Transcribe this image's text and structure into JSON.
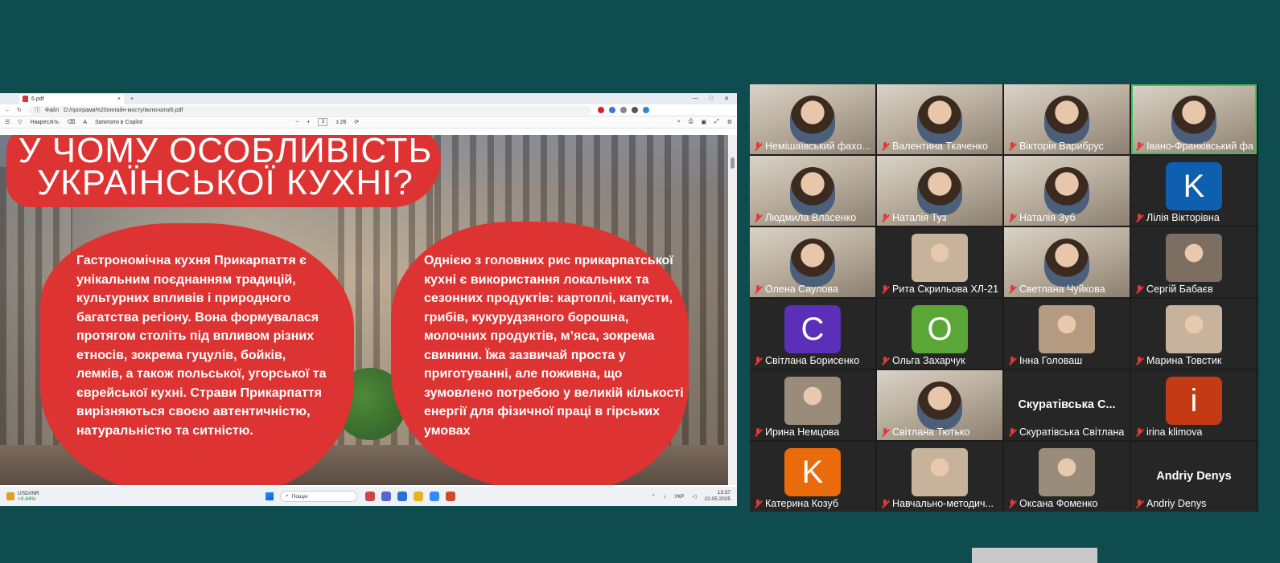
{
  "browser": {
    "tab_title": "6.pdf",
    "tab_close": "×",
    "new_tab": "+",
    "file_label": "Файл",
    "url": "D:/програма%20онлайн-мосту/включати/6.pdf",
    "draw_label": "Накресліть",
    "ask_copilot": "Запитати в Copilot",
    "page_current": "3",
    "page_total": "з 26",
    "zoom_minus": "−",
    "zoom_plus": "+"
  },
  "slide": {
    "title_line1": "У ЧОМУ ОСОБЛИВІСТЬ",
    "title_line2": "УКРАЇНСЬКОЇ КУХНІ?",
    "left_text": "Гастрономічна кухня Прикарпаття є унікальним поєднанням традицій, культурних впливів і природного багатства регіону. Вона формувалася протягом століть під впливом різних етносів, зокрема гуцулів, бойків, лемків, а також польської, угорської та єврейської кухні. Страви Прикарпаття вирізняються своєю автентичністю, натуральністю та ситністю.",
    "right_text": "Однією з головних рис прикарпатської кухні є використання локальних та сезонних продуктів: картоплі, капусти, грибів, кукурудзяного борошна, молочних продуктів, м’яса, зокрема свинини. Їжа зазвичай проста у приготуванні, але поживна, що зумовлено потребою у великій кількості енергії для фізичної праці в гірських умовах",
    "accent_color": "#dd3333"
  },
  "taskbar": {
    "ticker": "USD/INR",
    "ticker_change": "+0.44%",
    "search_placeholder": "Пошук",
    "lang": "УКР",
    "time": "13:37",
    "date": "22.05.2025"
  },
  "participants": [
    {
      "name": "Немішаївський фахо...",
      "type": "video"
    },
    {
      "name": "Валентина Ткаченко",
      "type": "video"
    },
    {
      "name": "Вікторія Варибрус",
      "type": "video"
    },
    {
      "name": "Івано-Франківський фах...",
      "type": "video",
      "active": true
    },
    {
      "name": "Людмила Власенко",
      "type": "video"
    },
    {
      "name": "Наталія Туз",
      "type": "video"
    },
    {
      "name": "Наталія Зуб",
      "type": "video"
    },
    {
      "name": "Лілія Вікторівна",
      "type": "avatar",
      "initial": "K",
      "color": "#0e5fb0"
    },
    {
      "name": "Олена Саулова",
      "type": "video"
    },
    {
      "name": "Рита Скрильова ХЛ-21",
      "type": "photo"
    },
    {
      "name": "Светлана Чуйкова",
      "type": "video"
    },
    {
      "name": "Сергій Бабаєв",
      "type": "photo"
    },
    {
      "name": "Світлана Борисенко",
      "type": "avatar",
      "initial": "C",
      "color": "#5b2fb8"
    },
    {
      "name": "Ольга Захарчук",
      "type": "avatar",
      "initial": "O",
      "color": "#5aa637"
    },
    {
      "name": "Інна Головаш",
      "type": "photo"
    },
    {
      "name": "Марина Товстик",
      "type": "photo"
    },
    {
      "name": "Ирина Немцова",
      "type": "photo"
    },
    {
      "name": "Світлана Тютько",
      "type": "video"
    },
    {
      "name": "Скуратівська Світлана",
      "type": "text",
      "display": "Скуратівська С..."
    },
    {
      "name": "irina klimova",
      "type": "avatar",
      "initial": "i",
      "color": "#c33a14"
    },
    {
      "name": "Катерина Козуб",
      "type": "avatar",
      "initial": "K",
      "color": "#ea6b0c"
    },
    {
      "name": "Навчально-методич...",
      "type": "photo"
    },
    {
      "name": "Оксана Фоменко",
      "type": "photo"
    },
    {
      "name": "Andriy Denys",
      "type": "text",
      "display": "Andriy Denys"
    }
  ]
}
